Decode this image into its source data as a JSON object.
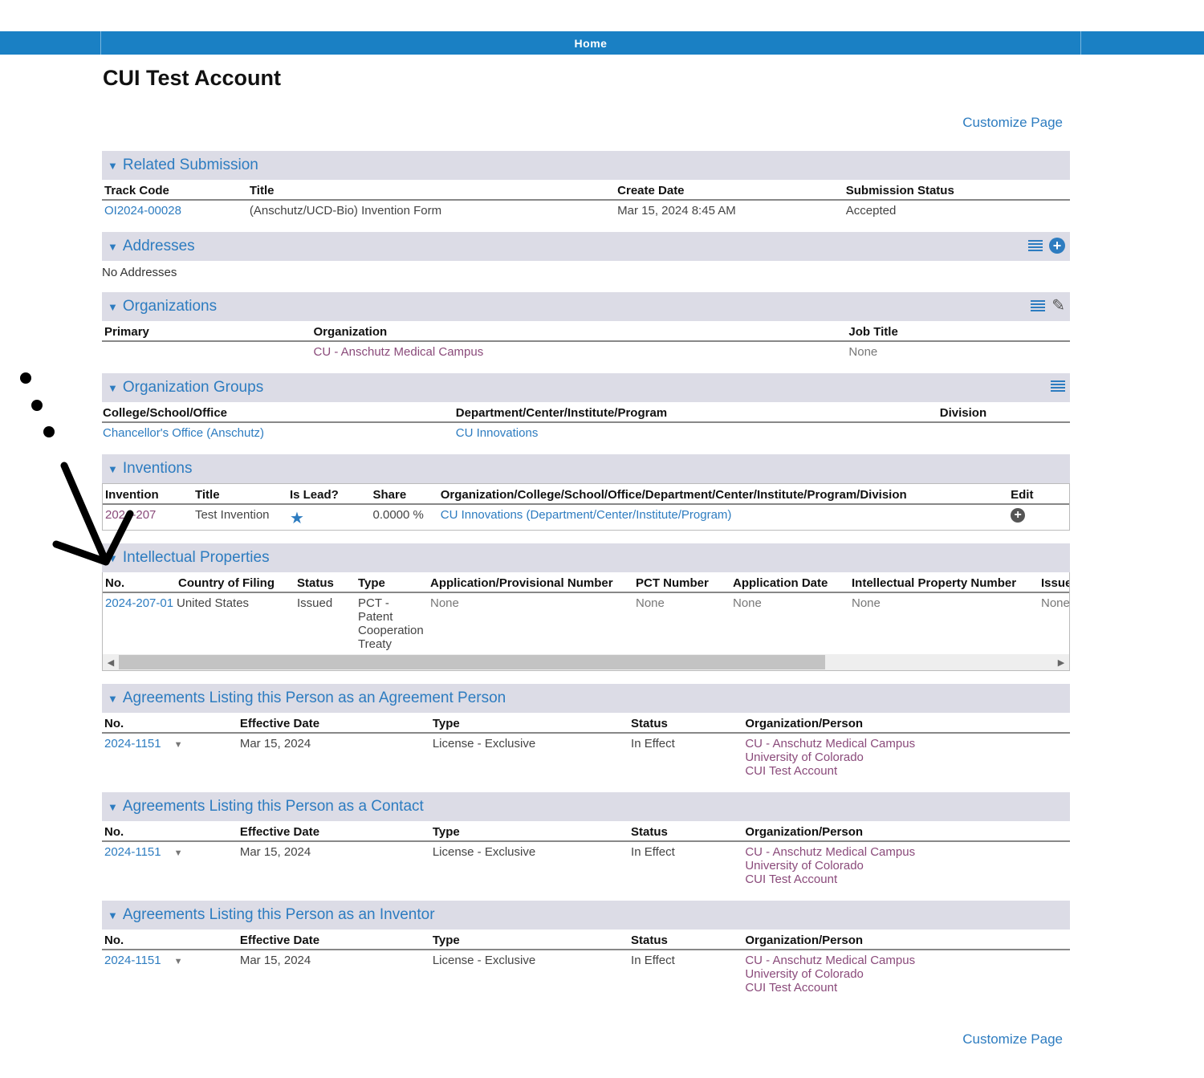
{
  "nav": {
    "home": "Home"
  },
  "page": {
    "title": "CUI Test Account",
    "customize": "Customize Page"
  },
  "related_submission": {
    "title": "Related Submission",
    "columns": [
      "Track Code",
      "Title",
      "Create Date",
      "Submission Status"
    ],
    "row": {
      "track_code": "OI2024-00028",
      "title": "(Anschutz/UCD-Bio) Invention Form",
      "create_date": "Mar 15, 2024 8:45 AM",
      "status": "Accepted"
    }
  },
  "addresses": {
    "title": "Addresses",
    "empty": "No Addresses"
  },
  "organizations": {
    "title": "Organizations",
    "columns": [
      "Primary",
      "Organization",
      "Job Title"
    ],
    "row": {
      "primary": "",
      "organization": "CU - Anschutz Medical Campus",
      "job_title": "None"
    }
  },
  "organization_groups": {
    "title": "Organization Groups",
    "columns": [
      "College/School/Office",
      "Department/Center/Institute/Program",
      "Division"
    ],
    "row": {
      "college": "Chancellor's Office (Anschutz)",
      "department": "CU Innovations",
      "division": ""
    }
  },
  "inventions": {
    "title": "Inventions",
    "columns": [
      "Invention",
      "Title",
      "Is Lead?",
      "Share",
      "Organization/College/School/Office/Department/Center/Institute/Program/Division",
      "Edit"
    ],
    "row": {
      "invention": "2024-207",
      "title": "Test Invention",
      "share": "0.0000 %",
      "org": "CU Innovations (Department/Center/Institute/Program)"
    }
  },
  "intellectual_properties": {
    "title": "Intellectual Properties",
    "columns": [
      "No.",
      "Country of Filing",
      "Status",
      "Type",
      "Application/Provisional Number",
      "PCT Number",
      "Application Date",
      "Intellectual Property Number",
      "Issue"
    ],
    "row": {
      "no": "2024-207-01",
      "country": "United States",
      "status": "Issued",
      "type_lines": [
        "PCT -",
        "Patent",
        "Cooperation",
        "Treaty"
      ],
      "app_number": "None",
      "pct_number": "None",
      "app_date": "None",
      "ip_number": "None",
      "issue": "None"
    }
  },
  "agreements_columns": [
    "No.",
    "Effective Date",
    "Type",
    "Status",
    "Organization/Person"
  ],
  "agreement_sections": [
    {
      "title": "Agreements Listing this Person as an Agreement Person",
      "row": {
        "no": "2024-1151",
        "date": "Mar 15, 2024",
        "type": "License - Exclusive",
        "status": "In Effect",
        "orgs": [
          "CU - Anschutz Medical Campus",
          "University of Colorado",
          "CUI Test Account"
        ]
      }
    },
    {
      "title": "Agreements Listing this Person as a Contact",
      "row": {
        "no": "2024-1151",
        "date": "Mar 15, 2024",
        "type": "License - Exclusive",
        "status": "In Effect",
        "orgs": [
          "CU - Anschutz Medical Campus",
          "University of Colorado",
          "CUI Test Account"
        ]
      }
    },
    {
      "title": "Agreements Listing this Person as an Inventor",
      "row": {
        "no": "2024-1151",
        "date": "Mar 15, 2024",
        "type": "License - Exclusive",
        "status": "In Effect",
        "orgs": [
          "CU - Anschutz Medical Campus",
          "University of Colorado",
          "CUI Test Account"
        ]
      }
    }
  ],
  "colors": {
    "accent": "#2d7cc0",
    "nav_bar": "#1a80c4",
    "section_header": "#dcdce6",
    "org_link": "#8a4a7a"
  }
}
